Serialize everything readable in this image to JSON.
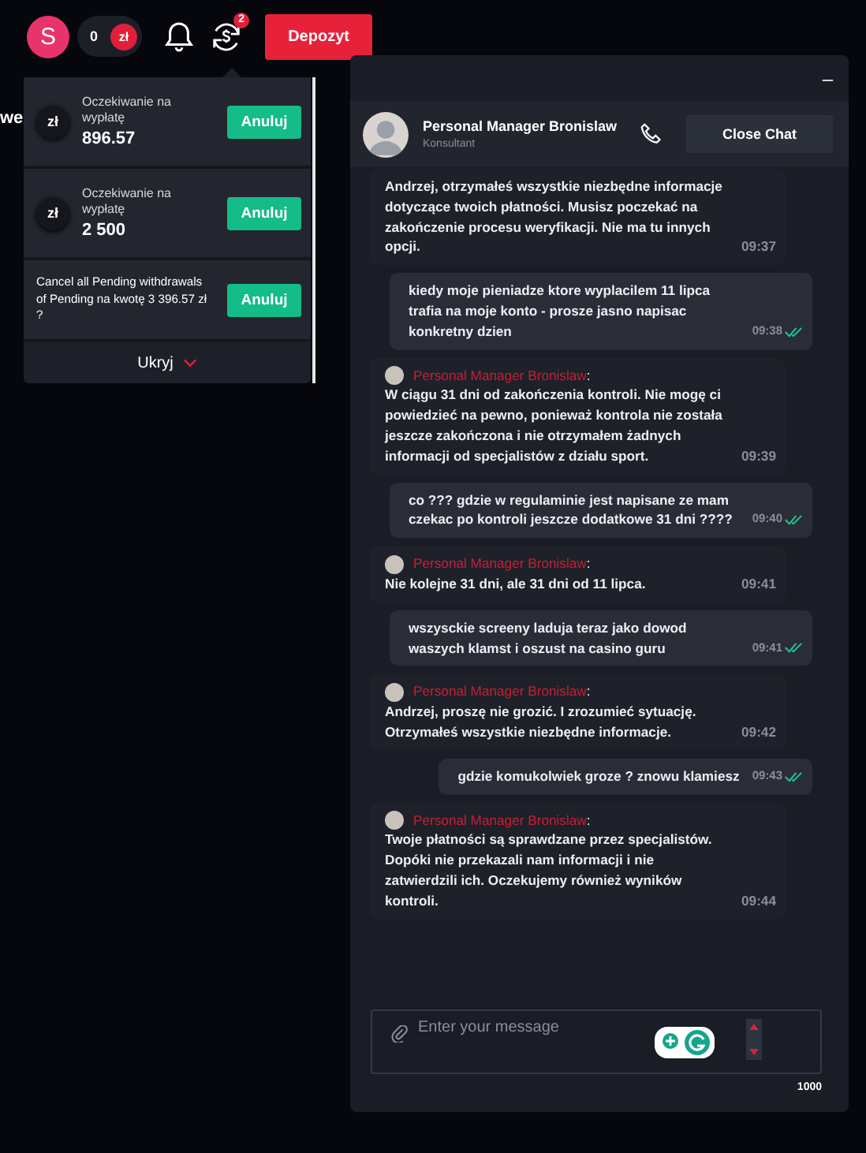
{
  "topbar": {
    "avatar_letter": "S",
    "balance": "0",
    "currency": "zł",
    "badge": "2",
    "deposit_button": "Depozyt"
  },
  "side_text": "we",
  "withdrawals": {
    "items": [
      {
        "currency": "zł",
        "label": "Oczekiwanie na wypłatę",
        "amount": "896.57",
        "button": "Anuluj"
      },
      {
        "currency": "zł",
        "label": "Oczekiwanie na wypłatę",
        "amount": "2 500",
        "button": "Anuluj"
      }
    ],
    "cancel_all": {
      "text": "Cancel all Pending withdrawals of Pending na kwotę 3 396.57 zł ?",
      "button": "Anuluj"
    },
    "hide_link": "Ukryj"
  },
  "chat": {
    "minimize": "–",
    "agent_name": "Personal Manager Bronislaw",
    "agent_role": "Konsultant",
    "close_button": "Close Chat",
    "messages": [
      {
        "kind": "agent",
        "text": "Andrzej, otrzymałeś wszystkie niezbędne informacje dotyczące twoich płatności. Musisz poczekać na zakończenie procesu weryfikacji. Nie ma tu innych opcji.",
        "time": "09:37"
      },
      {
        "kind": "user",
        "text": "kiedy moje pieniadze ktore wyplacilem 11 lipca trafia na moje konto - prosze jasno napisac konkretny dzien",
        "time": "09:38"
      },
      {
        "kind": "agent",
        "sender": "Personal Manager Bronislaw",
        "colon": ":",
        "text": "W ciągu 31 dni od zakończenia kontroli. Nie mogę ci powiedzieć na pewno, ponieważ kontrola nie została jeszcze zakończona i nie otrzymałem żadnych informacji od specjalistów z działu sport.",
        "time": "09:39"
      },
      {
        "kind": "user",
        "text": "co ??? gdzie w regulaminie jest napisane ze mam czekac po kontroli jeszcze dodatkowe 31 dni ????",
        "time": "09:40"
      },
      {
        "kind": "agent",
        "sender": "Personal Manager Bronislaw",
        "colon": ":",
        "text": "Nie kolejne 31 dni, ale 31 dni od 11 lipca.",
        "time": "09:41"
      },
      {
        "kind": "user",
        "text": "wszysckie screeny laduja teraz jako dowod waszych klamst i oszust na casino guru",
        "time": "09:41"
      },
      {
        "kind": "agent",
        "sender": "Personal Manager Bronislaw",
        "colon": ":",
        "text": "Andrzej, proszę nie grozić. I zrozumieć sytuację. Otrzymałeś wszystkie niezbędne informacje.",
        "time": "09:42"
      },
      {
        "kind": "user",
        "text": "gdzie komukolwiek groze ? znowu klamiesz",
        "time": "09:43"
      },
      {
        "kind": "agent",
        "sender": "Personal Manager Bronislaw",
        "colon": ":",
        "text": "Twoje płatności są sprawdzane przez specjalistów. Dopóki nie przekazali nam informacji i nie zatwierdzili ich. Oczekujemy również wyników kontroli.",
        "time": "09:44"
      }
    ],
    "input": {
      "placeholder": "Enter your message"
    },
    "char_count": "1000"
  }
}
